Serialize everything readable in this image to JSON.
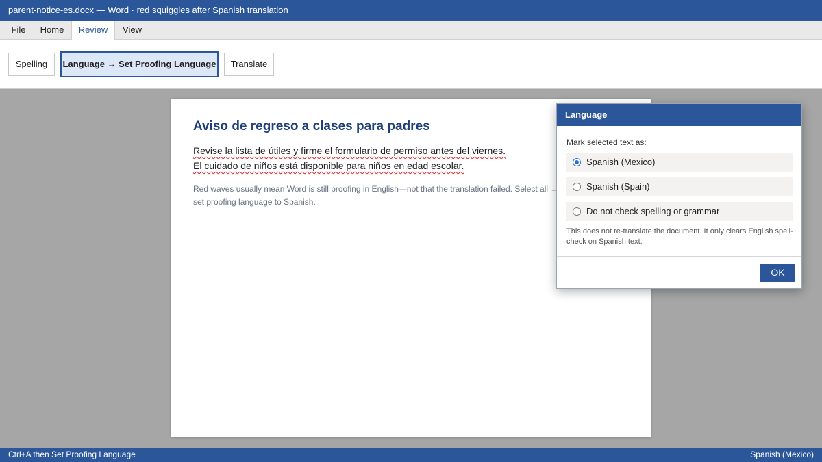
{
  "window": {
    "title": "parent-notice-es.docx — Word · red squiggles after Spanish translation"
  },
  "menu": {
    "tabs": [
      "File",
      "Home",
      "Review",
      "View"
    ],
    "active": "Review"
  },
  "ribbon": {
    "spelling": "Spelling",
    "language": "Language → Set Proofing Language",
    "translate": "Translate"
  },
  "document": {
    "title": "Aviso de regreso a clases para padres",
    "line1": "Revise la lista de útiles y firme el formulario de permiso antes del viernes.",
    "line2": "El cuidado de niños está disponible para niños en edad escolar.",
    "note": "Red waves usually mean Word is still proofing in English—not that the translation failed. Select all → set proofing language to Spanish."
  },
  "dialog": {
    "title": "Language",
    "prompt": "Mark selected text as:",
    "options": [
      "Spanish (Mexico)",
      "Spanish (Spain)",
      "Do not check spelling or grammar"
    ],
    "selected": "Spanish (Mexico)",
    "note": "This does not re-translate the document. It only clears English spell-check on Spanish text.",
    "ok": "OK"
  },
  "status": {
    "left": "Ctrl+A then Set Proofing Language",
    "right": "Spanish (Mexico)"
  },
  "colors": {
    "accent": "#2b579a",
    "squiggle": "#e02020",
    "heading": "#1f3f7a"
  }
}
